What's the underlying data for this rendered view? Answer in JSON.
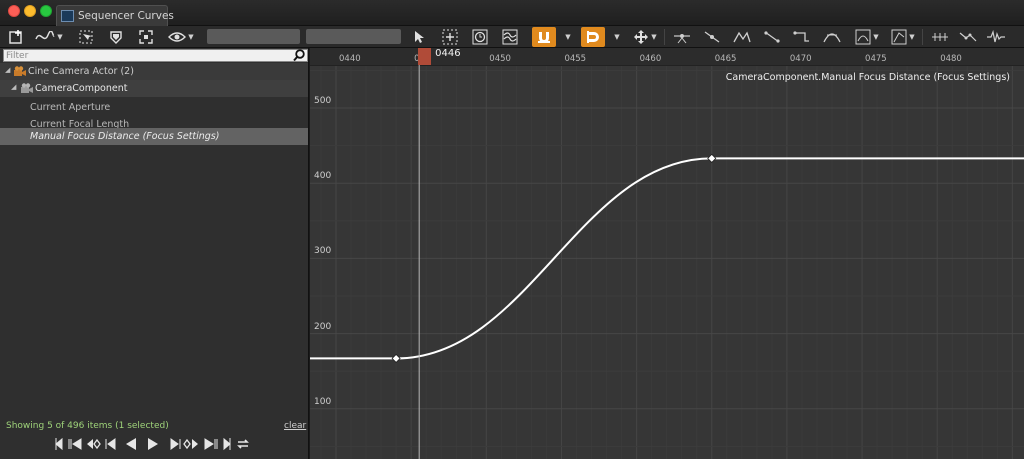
{
  "window": {
    "tab_title": "Sequencer Curves"
  },
  "toolbar": {
    "icons": [
      "add-key-icon",
      "curve-interp-icon",
      "select-all-icon",
      "fit-vertical-icon",
      "frame-icon",
      "view-options-icon",
      "select-tool-icon",
      "transform-tool-icon",
      "retime-tool-icon",
      "multi-curve-icon",
      "snap-magnet-icon",
      "snap-time-icon",
      "pan-icon",
      "flatten-tangents-icon",
      "straighten-icon",
      "auto-tangent-icon",
      "linear-icon",
      "constant-icon",
      "cubic-icon",
      "infinity-icon",
      "tangent-break-icon",
      "bake-icon",
      "reduce-icon",
      "filter-icon"
    ],
    "accent": "#e08a1e"
  },
  "filter": {
    "placeholder": "Filter"
  },
  "tree": {
    "actor": "Cine Camera Actor (2)",
    "component": "CameraComponent",
    "items": [
      "Current Aperture",
      "Current Focal Length",
      "Manual Focus Distance (Focus Settings)"
    ]
  },
  "status": {
    "summary": "Showing 5 of 496 items (1 selected)",
    "clear": "clear"
  },
  "graph": {
    "curve_label": "CameraComponent.Manual Focus Distance (Focus Settings)",
    "playhead_frame": "0446",
    "playhead_value": 446,
    "x_ticks": [
      {
        "value": 440,
        "label": "0440"
      },
      {
        "value": 445,
        "label": "044"
      },
      {
        "value": 450,
        "label": "0450"
      },
      {
        "value": 455,
        "label": "0455"
      },
      {
        "value": 460,
        "label": "0460"
      },
      {
        "value": 465,
        "label": "0465"
      },
      {
        "value": 470,
        "label": "0470"
      },
      {
        "value": 475,
        "label": "0475"
      },
      {
        "value": 480,
        "label": "0480"
      }
    ],
    "y_ticks": [
      {
        "value": 500,
        "label": "500"
      },
      {
        "value": 400,
        "label": "400"
      },
      {
        "value": 300,
        "label": "300"
      },
      {
        "value": 200,
        "label": "200"
      },
      {
        "value": 100,
        "label": "100"
      }
    ],
    "keys": [
      {
        "frame": 444,
        "value": 167
      },
      {
        "frame": 465,
        "value": 433
      }
    ],
    "curve_color": "#ffffff"
  }
}
